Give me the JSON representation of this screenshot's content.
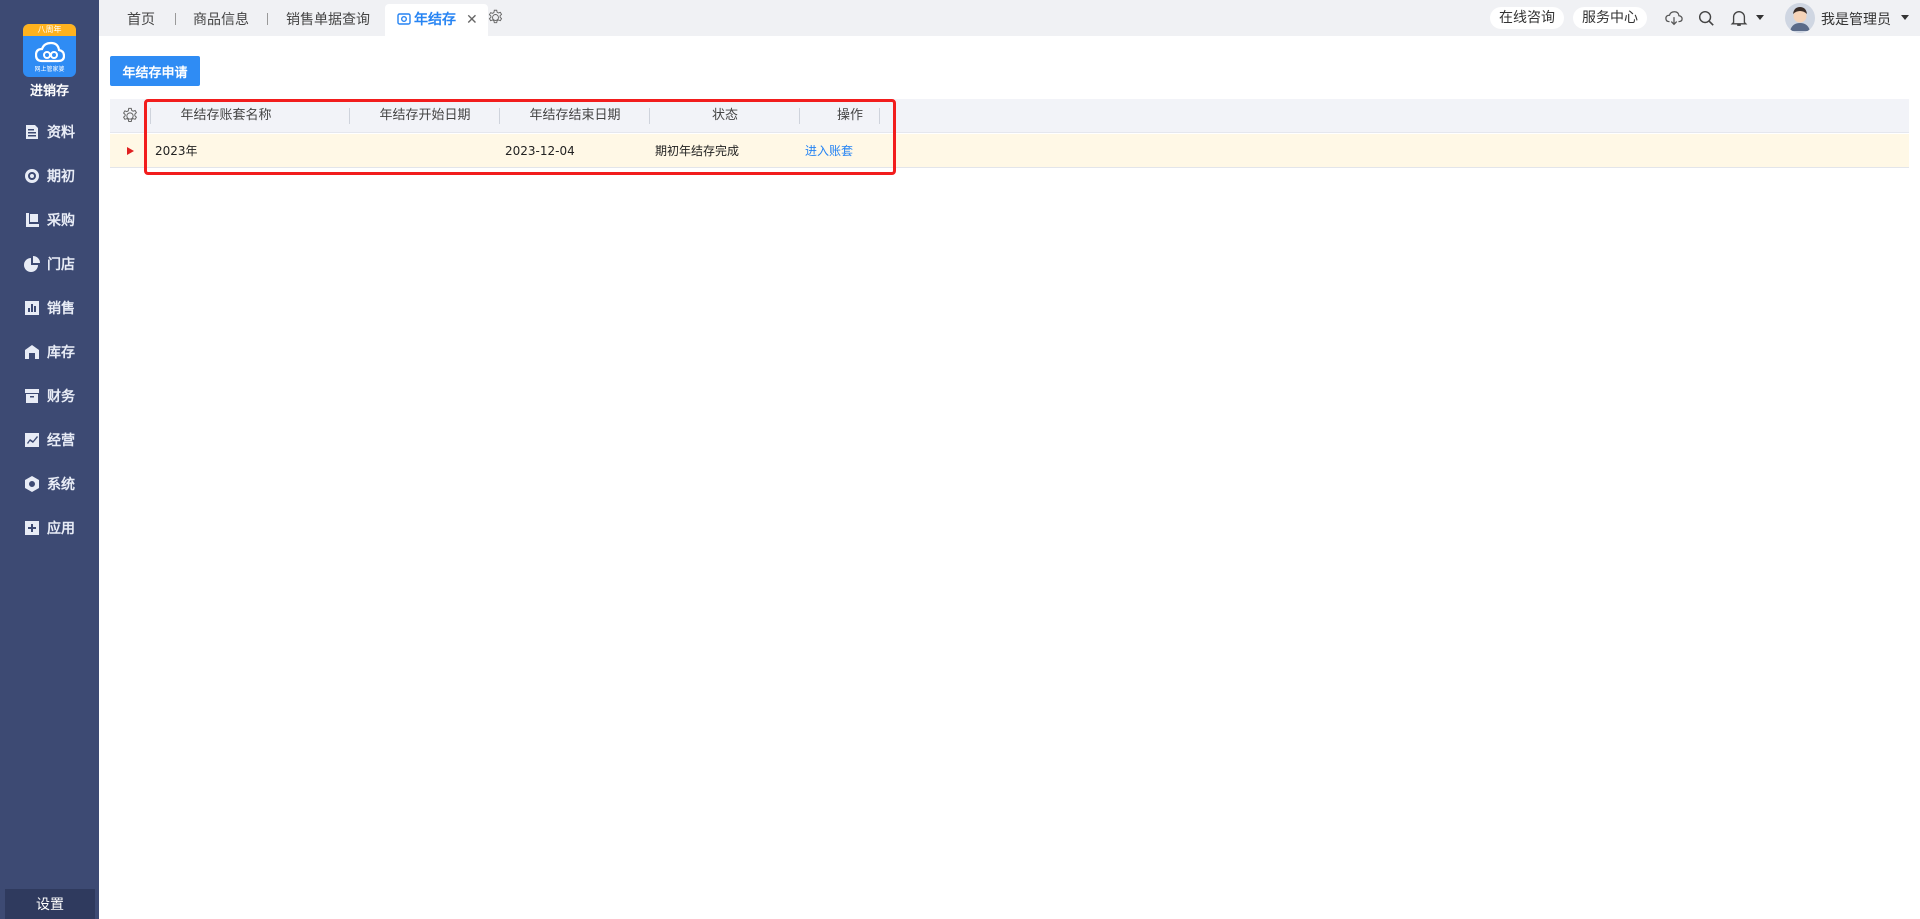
{
  "app": {
    "logo_ribbon": "八周年",
    "logo_sub": "网上管家婆",
    "logo_title": "进销存"
  },
  "sidebar": {
    "items": [
      {
        "label": "资料",
        "icon": "document-icon"
      },
      {
        "label": "期初",
        "icon": "target-icon"
      },
      {
        "label": "采购",
        "icon": "purchase-icon"
      },
      {
        "label": "门店",
        "icon": "pie-icon"
      },
      {
        "label": "销售",
        "icon": "bar-chart-icon"
      },
      {
        "label": "库存",
        "icon": "warehouse-icon"
      },
      {
        "label": "财务",
        "icon": "archive-icon"
      },
      {
        "label": "经营",
        "icon": "trend-icon"
      },
      {
        "label": "系统",
        "icon": "hexagon-icon"
      },
      {
        "label": "应用",
        "icon": "plus-square-icon"
      }
    ],
    "settings_label": "设置"
  },
  "tabs": [
    {
      "label": "首页"
    },
    {
      "label": "商品信息"
    },
    {
      "label": "销售单据查询"
    },
    {
      "label": "年结存",
      "active": true
    }
  ],
  "topbar": {
    "online_consult": "在线咨询",
    "service_center": "服务中心",
    "user_name": "我是管理员"
  },
  "toolbar": {
    "apply_button": "年结存申请"
  },
  "table": {
    "columns": [
      "年结存账套名称",
      "年结存开始日期",
      "年结存结束日期",
      "状态",
      "操作"
    ],
    "rows": [
      {
        "name": "2023年",
        "start_date": "",
        "end_date": "2023-12-04",
        "status": "期初年结存完成",
        "action": "进入账套"
      }
    ]
  },
  "colors": {
    "sidebar_bg": "#3d4a73",
    "accent": "#2f8cf4",
    "highlight": "#f21d1d",
    "row_selected": "#fff8e6"
  }
}
